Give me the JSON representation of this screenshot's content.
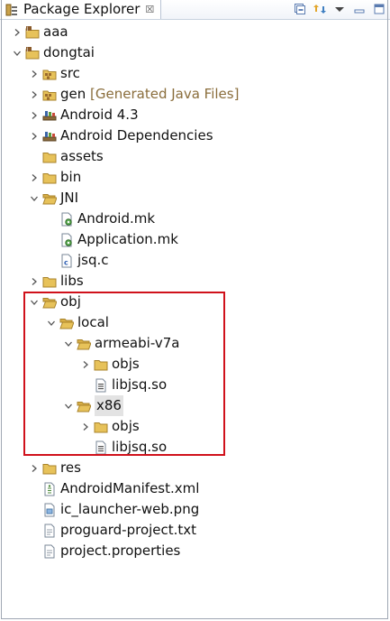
{
  "view": {
    "title": "Package Explorer",
    "close_glyph": "☒"
  },
  "tree": [
    {
      "label": "aaa",
      "icon": "project-icon",
      "depth": 0,
      "state": "collapsed"
    },
    {
      "label": "dongtai",
      "icon": "project-icon",
      "depth": 0,
      "state": "expanded"
    },
    {
      "label": "src",
      "icon": "package-folder-icon",
      "depth": 1,
      "state": "collapsed"
    },
    {
      "label": "gen",
      "decoration": "[Generated Java Files]",
      "icon": "package-folder-icon",
      "depth": 1,
      "state": "collapsed"
    },
    {
      "label": "Android 4.3",
      "icon": "library-icon",
      "depth": 1,
      "state": "collapsed"
    },
    {
      "label": "Android Dependencies",
      "icon": "library-icon",
      "depth": 1,
      "state": "collapsed"
    },
    {
      "label": "assets",
      "icon": "folder-icon",
      "depth": 1,
      "state": "none"
    },
    {
      "label": "bin",
      "icon": "folder-icon",
      "depth": 1,
      "state": "collapsed"
    },
    {
      "label": "JNI",
      "icon": "folder-open-icon",
      "depth": 1,
      "state": "expanded"
    },
    {
      "label": "Android.mk",
      "icon": "mk-file-icon",
      "depth": 2,
      "state": "none"
    },
    {
      "label": "Application.mk",
      "icon": "mk-file-icon",
      "depth": 2,
      "state": "none"
    },
    {
      "label": "jsq.c",
      "icon": "c-file-icon",
      "depth": 2,
      "state": "none"
    },
    {
      "label": "libs",
      "icon": "folder-icon",
      "depth": 1,
      "state": "collapsed"
    },
    {
      "label": "obj",
      "icon": "folder-open-icon",
      "depth": 1,
      "state": "expanded"
    },
    {
      "label": "local",
      "icon": "folder-open-icon",
      "depth": 2,
      "state": "expanded"
    },
    {
      "label": "armeabi-v7a",
      "icon": "folder-open-icon",
      "depth": 3,
      "state": "expanded"
    },
    {
      "label": "objs",
      "icon": "folder-icon",
      "depth": 4,
      "state": "collapsed"
    },
    {
      "label": "libjsq.so",
      "icon": "binary-file-icon",
      "depth": 4,
      "state": "none"
    },
    {
      "label": "x86",
      "icon": "folder-open-icon",
      "depth": 3,
      "state": "expanded",
      "selected": true
    },
    {
      "label": "objs",
      "icon": "folder-icon",
      "depth": 4,
      "state": "collapsed"
    },
    {
      "label": "libjsq.so",
      "icon": "binary-file-icon",
      "depth": 4,
      "state": "none"
    },
    {
      "label": "res",
      "icon": "folder-icon",
      "depth": 1,
      "state": "collapsed"
    },
    {
      "label": "AndroidManifest.xml",
      "icon": "xml-file-icon",
      "depth": 1,
      "state": "none"
    },
    {
      "label": "ic_launcher-web.png",
      "icon": "image-file-icon",
      "depth": 1,
      "state": "none"
    },
    {
      "label": "proguard-project.txt",
      "icon": "text-file-icon",
      "depth": 1,
      "state": "none"
    },
    {
      "label": "project.properties",
      "icon": "text-file-icon",
      "depth": 1,
      "state": "none"
    }
  ],
  "colors": {
    "highlight_box": "#d0111b",
    "folder": "#e7c25a",
    "accent_blue": "#2f6fb6"
  }
}
